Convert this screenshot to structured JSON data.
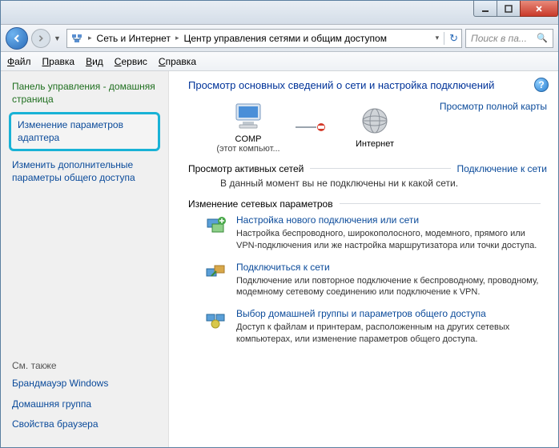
{
  "titlebar": {
    "min_icon": "minimize-icon",
    "max_icon": "maximize-icon",
    "close_icon": "close-icon"
  },
  "navbar": {
    "breadcrumb": {
      "part1": "Сеть и Интернет",
      "part2": "Центр управления сетями и общим доступом"
    },
    "search_placeholder": "Поиск в па..."
  },
  "menubar": {
    "file": "айл",
    "file_u": "Ф",
    "edit": "равка",
    "edit_u": "П",
    "view": "ид",
    "view_u": "В",
    "tools": "ервис",
    "tools_u": "С",
    "help": "правка",
    "help_u": "С"
  },
  "sidebar": {
    "home": "Панель управления - домашняя страница",
    "adapter": "Изменение параметров адаптера",
    "sharing": "Изменить дополнительные параметры общего доступа",
    "see_also": "См. также",
    "firewall": "Брандмауэр Windows",
    "homegroup": "Домашняя группа",
    "inet_opts": "Свойства браузера"
  },
  "main": {
    "title": "Просмотр основных сведений о сети и настройка подключений",
    "full_map": "Просмотр полной карты",
    "map_comp": "COMP",
    "map_comp_sub": "(этот компьют...",
    "map_internet": "Интернет",
    "active_title": "Просмотр активных сетей",
    "connect_link": "Подключение к сети",
    "no_conn": "В данный момент вы не подключены ни к какой сети.",
    "change_title": "Изменение сетевых параметров",
    "tasks": [
      {
        "title": "Настройка нового подключения или сети",
        "desc": "Настройка беспроводного, широкополосного, модемного, прямого или VPN-подключения или же настройка маршрутизатора или точки доступа."
      },
      {
        "title": "Подключиться к сети",
        "desc": "Подключение или повторное подключение к беспроводному, проводному, модемному сетевому соединению или подключение к VPN."
      },
      {
        "title": "Выбор домашней группы и параметров общего доступа",
        "desc": "Доступ к файлам и принтерам, расположенным на других сетевых компьютерах, или изменение параметров общего доступа."
      }
    ]
  }
}
